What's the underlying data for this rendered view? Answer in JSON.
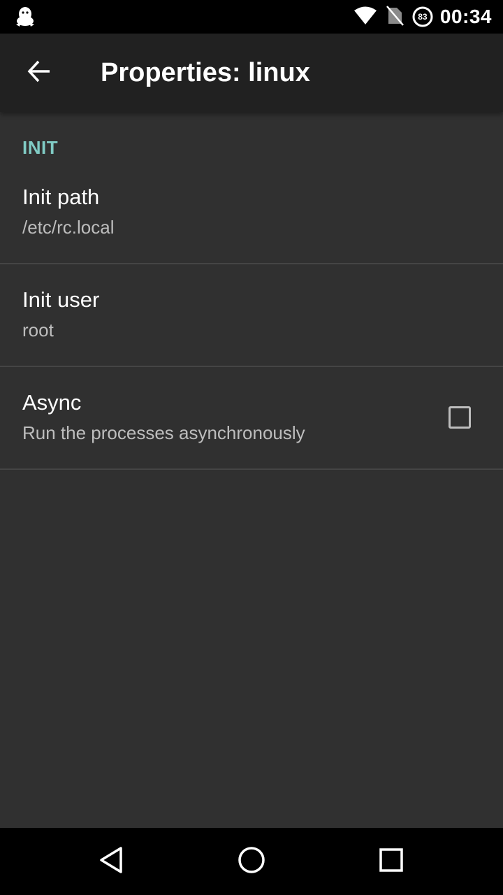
{
  "status_bar": {
    "time": "00:34",
    "battery_level": "83",
    "left_icon": "penguin-notification-icon",
    "icons": [
      "wifi-icon",
      "no-sim-icon",
      "battery-icon"
    ]
  },
  "toolbar": {
    "title": "Properties: linux",
    "back_icon": "arrow-back-icon"
  },
  "preferences": {
    "category": "INIT",
    "items": [
      {
        "title": "Init path",
        "summary": "/etc/rc.local"
      },
      {
        "title": "Init user",
        "summary": "root"
      },
      {
        "title": "Async",
        "summary": "Run the processes asynchronously",
        "checked": false
      }
    ]
  },
  "nav_bar": {
    "buttons": [
      "back-triangle-icon",
      "home-circle-icon",
      "recents-square-icon"
    ]
  },
  "colors": {
    "background": "#303030",
    "toolbar": "#212121",
    "accent": "#80cbc4",
    "status_bar": "#000000"
  }
}
